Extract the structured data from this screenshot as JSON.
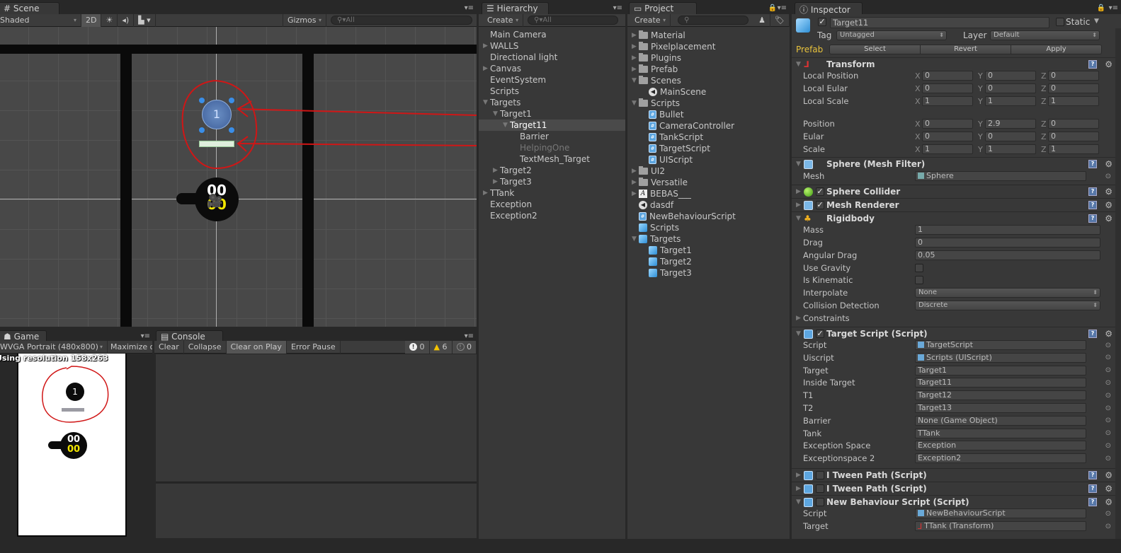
{
  "scene": {
    "tab": "Scene",
    "shading": "Shaded",
    "mode_2d": "2D",
    "gizmos": "Gizmos",
    "search_placeholder": "All"
  },
  "game": {
    "tab": "Game",
    "resolution": "WVGA Portrait (480x800)",
    "maximize": "Maximize on Play",
    "notice": "Using resolution 158x263",
    "target_number": "1",
    "tank_top": "00",
    "tank_bottom": "00"
  },
  "console": {
    "tab": "Console",
    "buttons": [
      "Clear",
      "Collapse",
      "Clear on Play",
      "Error Pause"
    ],
    "active_button": "Clear on Play",
    "counts": {
      "info": "0",
      "warnings": "6",
      "errors": "0"
    }
  },
  "hierarchy": {
    "tab": "Hierarchy",
    "create": "Create",
    "search_placeholder": "All",
    "items": [
      {
        "label": "Main Camera",
        "depth": 0,
        "arrow": ""
      },
      {
        "label": "WALLS",
        "depth": 0,
        "arrow": "right"
      },
      {
        "label": "Directional light",
        "depth": 0,
        "arrow": ""
      },
      {
        "label": "Canvas",
        "depth": 0,
        "arrow": "right"
      },
      {
        "label": "EventSystem",
        "depth": 0,
        "arrow": ""
      },
      {
        "label": "Scripts",
        "depth": 0,
        "arrow": ""
      },
      {
        "label": "Targets",
        "depth": 0,
        "arrow": "down"
      },
      {
        "label": "Target1",
        "depth": 1,
        "arrow": "down"
      },
      {
        "label": "Target11",
        "depth": 2,
        "arrow": "down",
        "selected": true
      },
      {
        "label": "Barrier",
        "depth": 3,
        "arrow": ""
      },
      {
        "label": "HelpingOne",
        "depth": 3,
        "arrow": "",
        "inactive": true
      },
      {
        "label": "TextMesh_Target",
        "depth": 3,
        "arrow": ""
      },
      {
        "label": "Target2",
        "depth": 1,
        "arrow": "right"
      },
      {
        "label": "Target3",
        "depth": 1,
        "arrow": "right"
      },
      {
        "label": "TTank",
        "depth": 0,
        "arrow": "right"
      },
      {
        "label": "Exception",
        "depth": 0,
        "arrow": ""
      },
      {
        "label": "Exception2",
        "depth": 0,
        "arrow": ""
      }
    ]
  },
  "project": {
    "tab": "Project",
    "create": "Create",
    "items": [
      {
        "label": "Material",
        "depth": 0,
        "arrow": "right",
        "icon": "folder"
      },
      {
        "label": "Pixelplacement",
        "depth": 0,
        "arrow": "right",
        "icon": "folder"
      },
      {
        "label": "Plugins",
        "depth": 0,
        "arrow": "right",
        "icon": "folder"
      },
      {
        "label": "Prefab",
        "depth": 0,
        "arrow": "right",
        "icon": "folder"
      },
      {
        "label": "Scenes",
        "depth": 0,
        "arrow": "down",
        "icon": "folder"
      },
      {
        "label": "MainScene",
        "depth": 1,
        "arrow": "",
        "icon": "unity"
      },
      {
        "label": "Scripts",
        "depth": 0,
        "arrow": "down",
        "icon": "folder"
      },
      {
        "label": "Bullet",
        "depth": 1,
        "arrow": "",
        "icon": "cs"
      },
      {
        "label": "CameraController",
        "depth": 1,
        "arrow": "",
        "icon": "cs"
      },
      {
        "label": "TankScript",
        "depth": 1,
        "arrow": "",
        "icon": "cs"
      },
      {
        "label": "TargetScript",
        "depth": 1,
        "arrow": "",
        "icon": "cs"
      },
      {
        "label": "UIScript",
        "depth": 1,
        "arrow": "",
        "icon": "cs"
      },
      {
        "label": "UI2",
        "depth": 0,
        "arrow": "right",
        "icon": "folder"
      },
      {
        "label": "Versatile",
        "depth": 0,
        "arrow": "right",
        "icon": "folder"
      },
      {
        "label": "BEBAS___",
        "depth": 0,
        "arrow": "right",
        "icon": "font"
      },
      {
        "label": "dasdf",
        "depth": 0,
        "arrow": "",
        "icon": "unity"
      },
      {
        "label": "NewBehaviourScript",
        "depth": 0,
        "arrow": "",
        "icon": "cs"
      },
      {
        "label": "Scripts",
        "depth": 0,
        "arrow": "",
        "icon": "prefab"
      },
      {
        "label": "Targets",
        "depth": 0,
        "arrow": "down",
        "icon": "prefab"
      },
      {
        "label": "Target1",
        "depth": 1,
        "arrow": "",
        "icon": "prefab"
      },
      {
        "label": "Target2",
        "depth": 1,
        "arrow": "",
        "icon": "prefab"
      },
      {
        "label": "Target3",
        "depth": 1,
        "arrow": "",
        "icon": "prefab"
      }
    ]
  },
  "inspector": {
    "tab": "Inspector",
    "object_name": "Target11",
    "active": true,
    "static_label": "Static",
    "tag_label": "Tag",
    "tag_value": "Untagged",
    "layer_label": "Layer",
    "layer_value": "Default",
    "prefab_label": "Prefab",
    "prefab_buttons": [
      "Select",
      "Revert",
      "Apply"
    ],
    "transform": {
      "title": "Transform",
      "rows": [
        {
          "label": "Local Position",
          "x": "0",
          "y": "0",
          "z": "0"
        },
        {
          "label": "Local Eular",
          "x": "0",
          "y": "0",
          "z": "0"
        },
        {
          "label": "Local Scale",
          "x": "1",
          "y": "1",
          "z": "1"
        },
        {
          "label": "Position",
          "x": "0",
          "y": "2.9",
          "z": "0"
        },
        {
          "label": "Eular",
          "x": "0",
          "y": "0",
          "z": "0"
        },
        {
          "label": "Scale",
          "x": "1",
          "y": "1",
          "z": "1"
        }
      ]
    },
    "mesh_filter": {
      "title": "Sphere (Mesh Filter)",
      "mesh_label": "Mesh",
      "mesh_value": "Sphere"
    },
    "sphere_collider": {
      "title": "Sphere Collider",
      "enabled": true
    },
    "mesh_renderer": {
      "title": "Mesh Renderer",
      "enabled": true
    },
    "rigidbody": {
      "title": "Rigidbody",
      "mass_label": "Mass",
      "mass": "1",
      "drag_label": "Drag",
      "drag": "0",
      "angular_drag_label": "Angular Drag",
      "angular_drag": "0.05",
      "use_gravity_label": "Use Gravity",
      "use_gravity": false,
      "is_kinematic_label": "Is Kinematic",
      "is_kinematic": false,
      "interpolate_label": "Interpolate",
      "interpolate": "None",
      "collision_label": "Collision Detection",
      "collision": "Discrete",
      "constraints_label": "Constraints"
    },
    "target_script": {
      "title": "Target Script (Script)",
      "enabled": true,
      "fields": [
        {
          "label": "Script",
          "value": "TargetScript"
        },
        {
          "label": "Uiscript",
          "value": "Scripts (UIScript)"
        },
        {
          "label": "Target",
          "value": "Target1"
        },
        {
          "label": "Inside Target",
          "value": "Target11"
        },
        {
          "label": "T1",
          "value": "Target12"
        },
        {
          "label": "T2",
          "value": "Target13"
        },
        {
          "label": "Barrier",
          "value": "None (Game Object)"
        },
        {
          "label": "Tank",
          "value": "TTank"
        },
        {
          "label": "Exception Space",
          "value": "Exception"
        },
        {
          "label": "Exceptionspace 2",
          "value": "Exception2"
        }
      ]
    },
    "itween1": {
      "title": "I Tween Path (Script)",
      "enabled": false
    },
    "itween2": {
      "title": "I Tween Path (Script)",
      "enabled": false
    },
    "new_behaviour": {
      "title": "New Behaviour Script (Script)",
      "enabled": false,
      "script_label": "Script",
      "script_value": "NewBehaviourScript",
      "target_label": "Target",
      "target_value": "TTank (Transform)"
    }
  }
}
